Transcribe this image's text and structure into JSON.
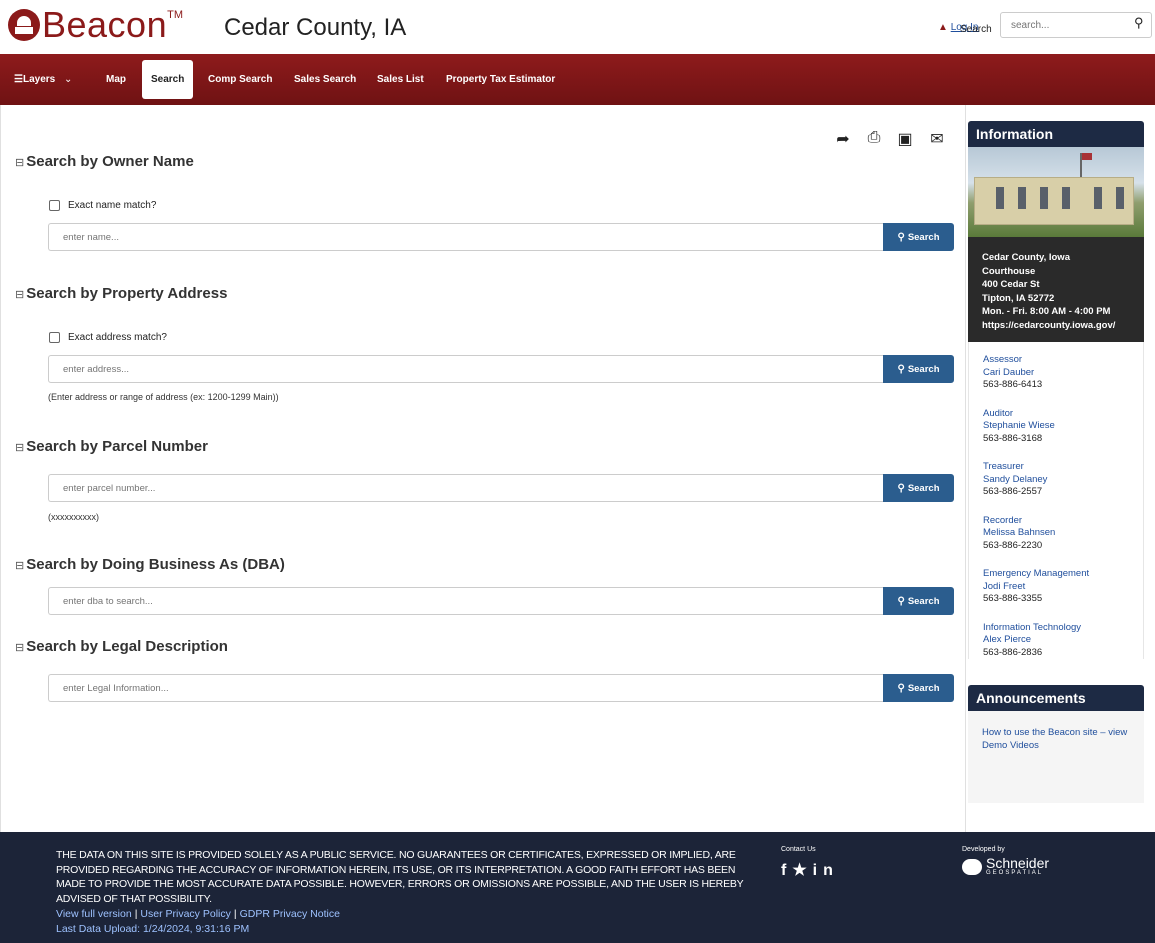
{
  "header": {
    "logo_text": "Beacon",
    "logo_tm": "TM",
    "county": "Cedar County, IA",
    "login": "Log In",
    "search_label": "Search",
    "search_placeholder": "search..."
  },
  "nav": {
    "layers": "Layers",
    "items": [
      "Map",
      "Search",
      "Comp Search",
      "Sales Search",
      "Sales List",
      "Property Tax Estimator"
    ],
    "active": "Search"
  },
  "tools": [
    "share-icon",
    "print-icon",
    "image-icon",
    "email-icon"
  ],
  "sections": [
    {
      "title": "Search by Owner Name",
      "checkbox": "Exact name match?",
      "placeholder": "enter name...",
      "button": "Search",
      "hint": ""
    },
    {
      "title": "Search by Property Address",
      "checkbox": "Exact address match?",
      "placeholder": "enter address...",
      "button": "Search",
      "hint": "(Enter address or range of address (ex: 1200-1299 Main))"
    },
    {
      "title": "Search by Parcel Number",
      "checkbox": "",
      "placeholder": "enter parcel number...",
      "button": "Search",
      "hint": "(xxxxxxxxxx)"
    },
    {
      "title": "Search by Doing Business As (DBA)",
      "checkbox": "",
      "placeholder": "enter dba to search...",
      "button": "Search",
      "hint": ""
    },
    {
      "title": "Search by Legal Description",
      "checkbox": "",
      "placeholder": "enter Legal Information...",
      "button": "Search",
      "hint": ""
    }
  ],
  "sidebar": {
    "info_title": "Information",
    "office": {
      "line1": "Cedar County, Iowa",
      "line2": "Courthouse",
      "line3": "400 Cedar St",
      "line4": "Tipton, IA 52772",
      "hours": "Mon. - Fri. 8:00 AM - 4:00 PM",
      "url": "https://cedarcounty.iowa.gov/"
    },
    "contacts": [
      {
        "role": "Assessor",
        "name": "Cari Dauber",
        "phone": "563-886-6413"
      },
      {
        "role": "Auditor",
        "name": "Stephanie Wiese",
        "phone": "563-886-3168"
      },
      {
        "role": "Treasurer",
        "name": "Sandy Delaney",
        "phone": "563-886-2557"
      },
      {
        "role": "Recorder",
        "name": "Melissa Bahnsen",
        "phone": "563-886-2230"
      },
      {
        "role": "Emergency Management",
        "name": "Jodi Freet",
        "phone": "563-886-3355"
      },
      {
        "role": "Information Technology",
        "name": "Alex Pierce",
        "phone": "563-886-2836"
      }
    ],
    "ann_title": "Announcements",
    "ann_link": "How to use the Beacon site – view Demo Videos"
  },
  "footer": {
    "disclaimer": "THE DATA ON THIS SITE IS PROVIDED SOLELY AS A PUBLIC SERVICE. NO GUARANTEES OR CERTIFICATES, EXPRESSED OR IMPLIED, ARE PROVIDED REGARDING THE ACCURACY OF INFORMATION HEREIN, ITS USE, OR ITS INTERPRETATION. A GOOD FAITH EFFORT HAS BEEN MADE TO PROVIDE THE MOST ACCURATE DATA POSSIBLE. HOWEVER, ERRORS OR OMISSIONS ARE POSSIBLE, AND THE USER IS HEREBY ADVISED OF THAT POSSIBILITY.",
    "links": [
      "View full version",
      "User Privacy Policy",
      "GDPR Privacy Notice"
    ],
    "upload": "Last Data Upload: 1/24/2024, 9:31:16 PM",
    "contact_us": "Contact Us",
    "developed_by": "Developed by",
    "dev_name": "Schneider",
    "dev_sub": "GEOSPATIAL"
  }
}
